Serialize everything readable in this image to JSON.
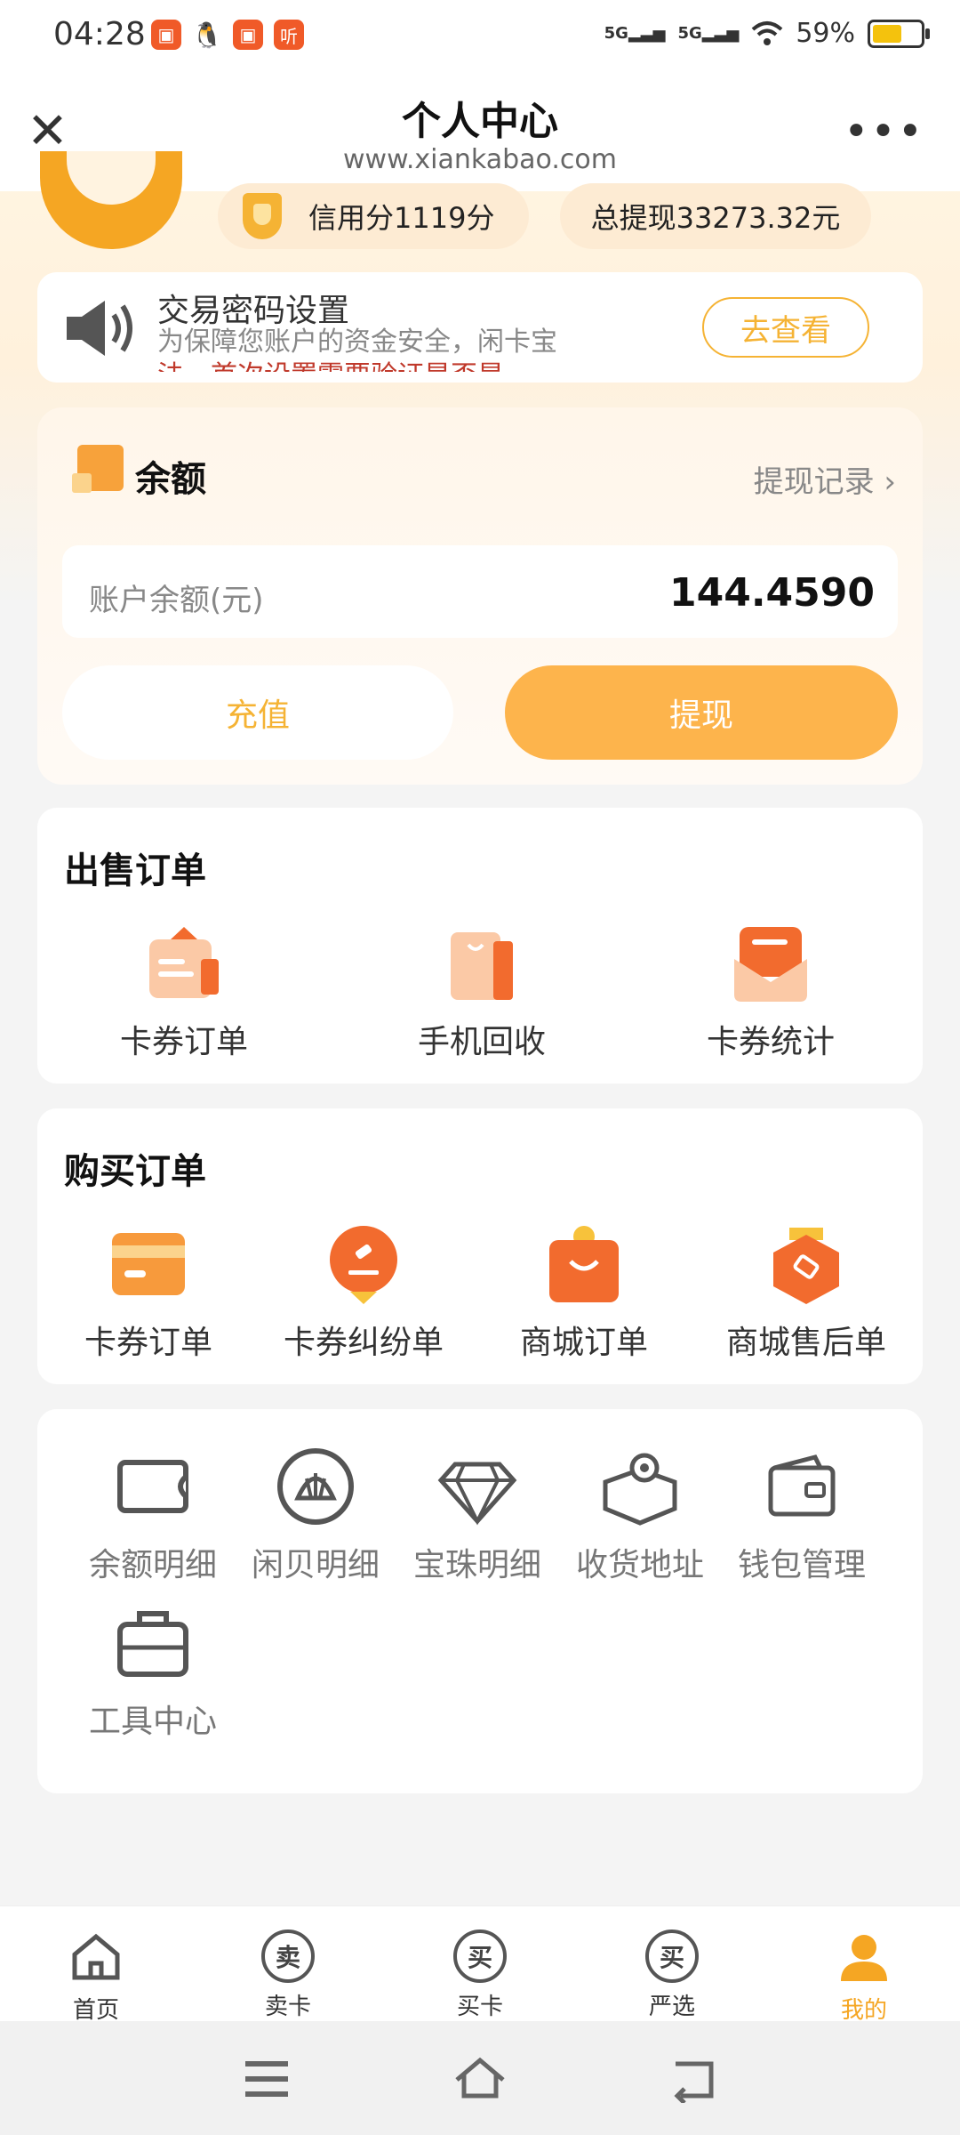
{
  "status_bar": {
    "time": "04:28",
    "app_icons": [
      "app-icon-1",
      "qq-icon",
      "app-icon-3",
      "listen-icon"
    ],
    "signal1": "5G",
    "signal2": "5G",
    "battery": "59%"
  },
  "nav": {
    "title": "个人中心",
    "url": "www.xiankabao.com"
  },
  "header": {
    "credit": "信用分1119分",
    "total_withdraw": "总提现33273.32元"
  },
  "notice": {
    "title": "交易密码设置",
    "line1": "为保障您账户的资金安全，闲卡宝",
    "line2": "法，首次设置需要验证是否是",
    "button": "去查看"
  },
  "balance": {
    "title": "余额",
    "record_link": "提现记录",
    "field_label": "账户余额(元)",
    "amount": "144.4590",
    "recharge": "充值",
    "withdraw": "提现"
  },
  "sell_orders": {
    "title": "出售订单",
    "items": [
      "卡券订单",
      "手机回收",
      "卡券统计"
    ]
  },
  "buy_orders": {
    "title": "购买订单",
    "items": [
      "卡券订单",
      "卡券纠纷单",
      "商城订单",
      "商城售后单"
    ]
  },
  "tools": {
    "items": [
      "余额明细",
      "闲贝明细",
      "宝珠明细",
      "收货地址",
      "钱包管理",
      "工具中心"
    ]
  },
  "tabs": [
    {
      "label": "首页",
      "glyph": ""
    },
    {
      "label": "卖卡",
      "glyph": "卖"
    },
    {
      "label": "买卡",
      "glyph": "买"
    },
    {
      "label": "严选",
      "glyph": "买"
    },
    {
      "label": "我的",
      "glyph": ""
    }
  ],
  "colors": {
    "accent": "#f5a623",
    "button_orange": "#fdb44c",
    "icon_orange": "#f26b2e"
  }
}
